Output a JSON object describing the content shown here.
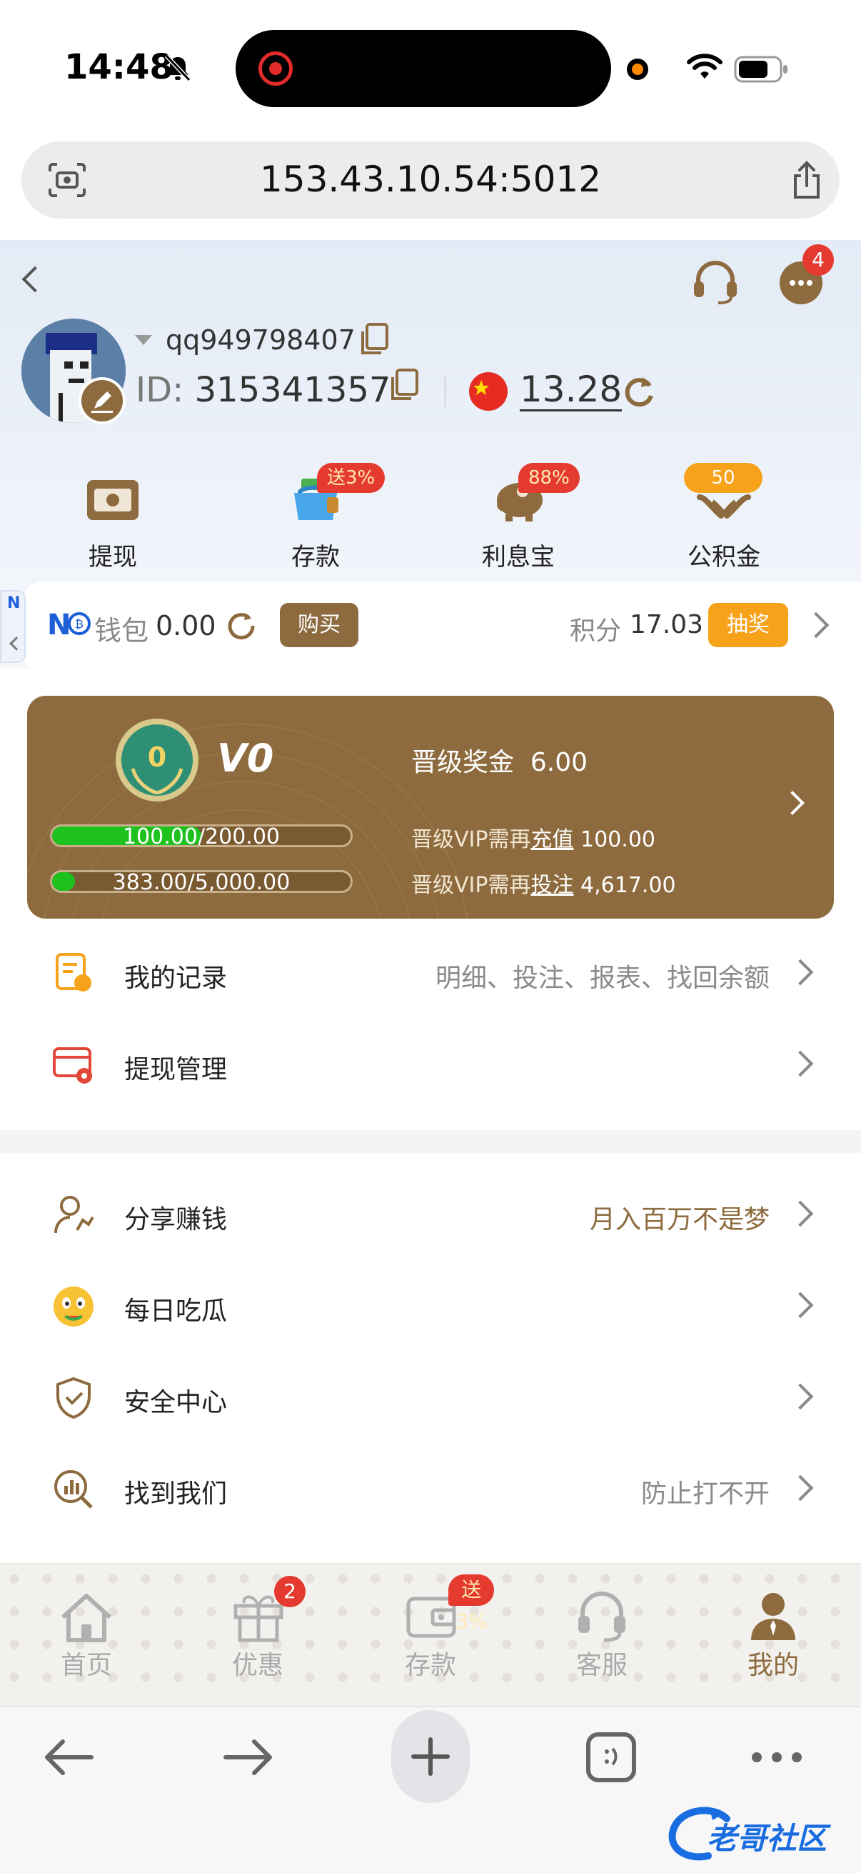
{
  "status_bar": {
    "time": "14:48"
  },
  "browser": {
    "url": "153.43.10.54:5012"
  },
  "header": {
    "username": "qq949798407",
    "id_label": "ID:",
    "id_value": "315341357",
    "balance": "13.28",
    "message_badge": "4"
  },
  "quick_actions": [
    {
      "label": "提现",
      "icon": "withdraw-icon",
      "badge": ""
    },
    {
      "label": "存款",
      "icon": "deposit-bag-icon",
      "badge": "送3%"
    },
    {
      "label": "利息宝",
      "icon": "piggy-bank-icon",
      "badge": "88%"
    },
    {
      "label": "公积金",
      "icon": "fund-hands-icon",
      "badge": "50"
    }
  ],
  "wallet": {
    "brand": "N",
    "label": "钱包",
    "amount": "0.00",
    "buy_label": "购买",
    "points_label": "积分",
    "points_value": "17.03",
    "lottery_label": "抽奖"
  },
  "side_tab": "N",
  "vip": {
    "medal_number": "0",
    "level": "V0",
    "bonus_label": "晋级奖金",
    "bonus_value": "6.00",
    "deposit_progress_text": "100.00/200.00",
    "deposit_progress_ratio": 0.5,
    "bet_progress_text": "383.00/5,000.00",
    "bet_progress_ratio": 0.0766,
    "deposit_need_prefix": "晋级VIP需再",
    "deposit_need_link": "充值",
    "deposit_need_value": "100.00",
    "bet_need_prefix": "晋级VIP需再",
    "bet_need_link": "投注",
    "bet_need_value": "4,617.00"
  },
  "menu_group1": [
    {
      "label": "我的记录",
      "hint": "明细、投注、报表、找回余额"
    },
    {
      "label": "提现管理",
      "hint": ""
    }
  ],
  "menu_group2": [
    {
      "label": "分享赚钱",
      "hint": "月入百万不是梦"
    },
    {
      "label": "每日吃瓜",
      "hint": ""
    },
    {
      "label": "安全中心",
      "hint": ""
    },
    {
      "label": "找到我们",
      "hint": "防止打不开"
    }
  ],
  "tabbar": [
    {
      "label": "首页",
      "badge": ""
    },
    {
      "label": "优惠",
      "badge": "2"
    },
    {
      "label": "存款",
      "badge": "送3%"
    },
    {
      "label": "客服",
      "badge": ""
    },
    {
      "label": "我的",
      "badge": ""
    }
  ],
  "watermark": "老哥社区",
  "colors": {
    "brand_brown": "#8d6b3e",
    "accent_orange": "#f7a21b",
    "badge_red": "#e53a2f"
  }
}
